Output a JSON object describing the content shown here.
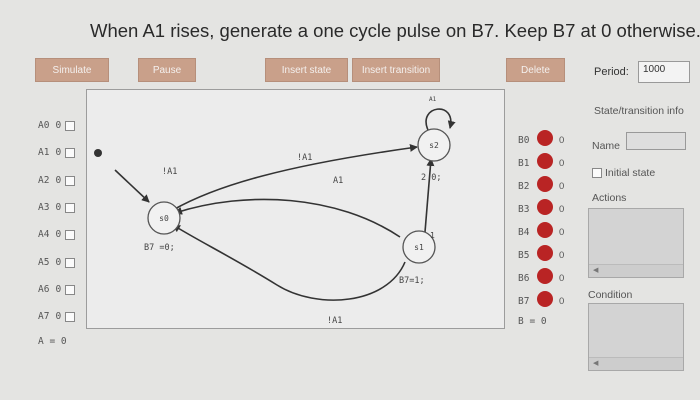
{
  "title": "When A1 rises, generate a one cycle pulse on B7. Keep B7 at 0 otherwise.",
  "toolbar": {
    "simulate": "Simulate",
    "pause": "Pause",
    "insert_state": "Insert state",
    "insert_transition": "Insert transition",
    "delete": "Delete",
    "period_label": "Period:",
    "period_value": "1000"
  },
  "inputs": [
    {
      "name": "A0",
      "value": "0"
    },
    {
      "name": "A1",
      "value": "0"
    },
    {
      "name": "A2",
      "value": "0"
    },
    {
      "name": "A3",
      "value": "0"
    },
    {
      "name": "A4",
      "value": "0"
    },
    {
      "name": "A5",
      "value": "0"
    },
    {
      "name": "A6",
      "value": "0"
    },
    {
      "name": "A7",
      "value": "0"
    }
  ],
  "input_summary": "A = 0",
  "outputs": [
    {
      "name": "B0",
      "value": "0"
    },
    {
      "name": "B1",
      "value": "0"
    },
    {
      "name": "B2",
      "value": "0"
    },
    {
      "name": "B3",
      "value": "0"
    },
    {
      "name": "B4",
      "value": "0"
    },
    {
      "name": "B5",
      "value": "0"
    },
    {
      "name": "B6",
      "value": "0"
    },
    {
      "name": "B7",
      "value": "0"
    }
  ],
  "output_summary": "B = 0",
  "output_led_color": "#b92424",
  "right_panel": {
    "title": "State/transition info",
    "name_label": "Name",
    "initial_state_label": "Initial state",
    "actions_label": "Actions",
    "condition_label": "Condition"
  },
  "diagram": {
    "states": [
      {
        "label": "s0",
        "action": "B7 =0;"
      },
      {
        "label": "s1",
        "action": "B7=1;"
      },
      {
        "label": "s2",
        "action": "2 0;"
      }
    ],
    "transitions": [
      {
        "label": "!A1"
      },
      {
        "label": "!A1"
      },
      {
        "label": "A1"
      },
      {
        "label": "!A1"
      },
      {
        "label": "A1"
      },
      {
        "label": "1"
      }
    ]
  }
}
